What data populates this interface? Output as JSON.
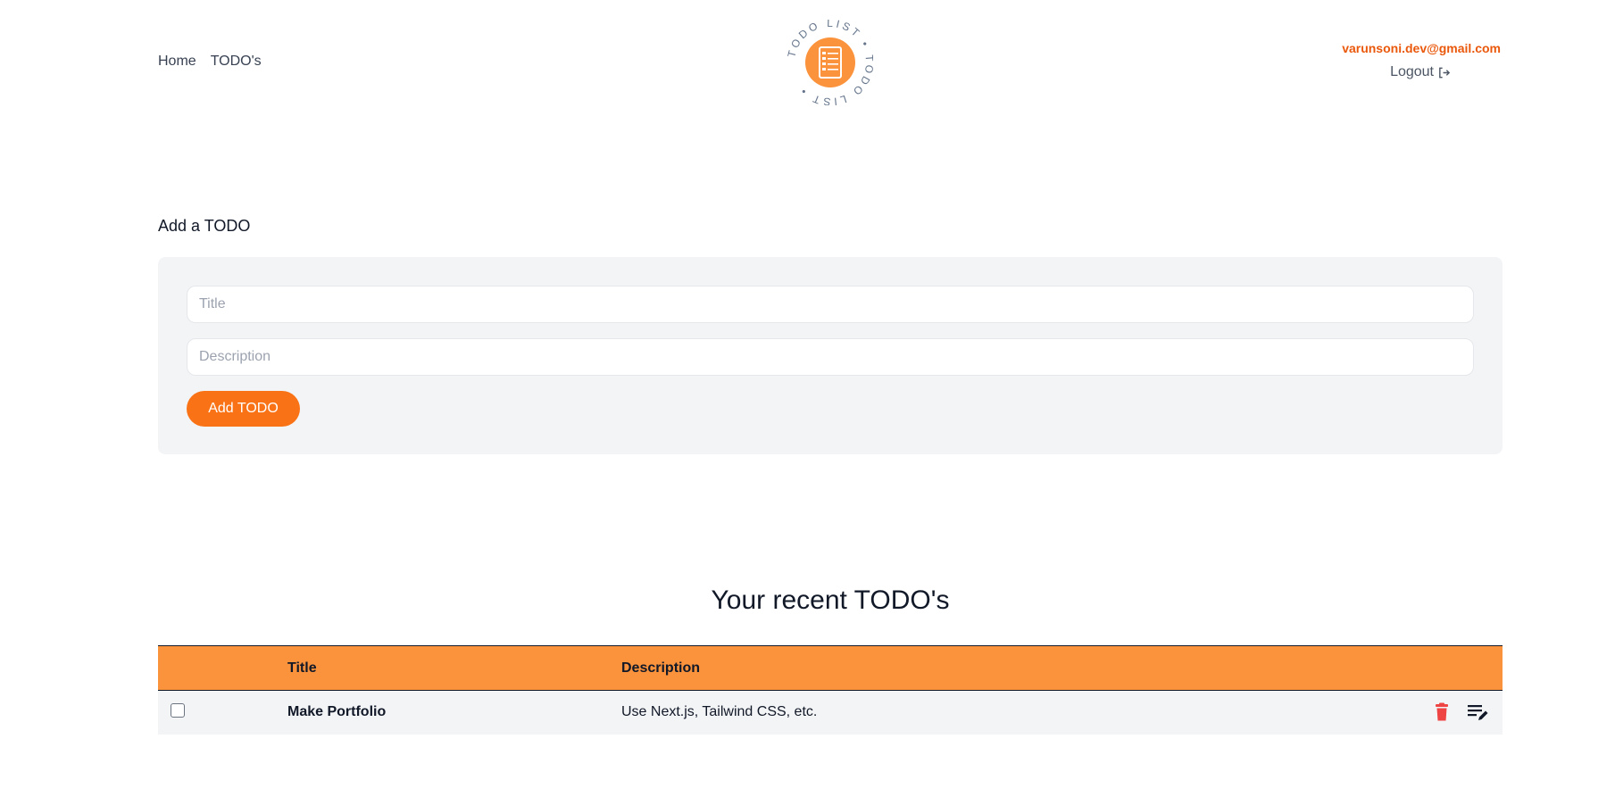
{
  "header": {
    "nav": [
      {
        "label": "Home"
      },
      {
        "label": "TODO's"
      }
    ],
    "logo": {
      "ring_text": "TODO LIST • TODO LIST •",
      "icon": "document-list-icon",
      "accent": "#fb923c"
    },
    "user_email": "varunsoni.dev@gmail.com",
    "logout_label": "Logout",
    "logout_icon": "logout-icon"
  },
  "add_form": {
    "heading": "Add a TODO",
    "title_placeholder": "Title",
    "title_value": "",
    "description_placeholder": "Description",
    "description_value": "",
    "submit_label": "Add TODO"
  },
  "recent": {
    "heading": "Your recent TODO's",
    "columns": [
      "",
      "Title",
      "Description",
      ""
    ],
    "rows": [
      {
        "checked": false,
        "title": "Make Portfolio",
        "description": "Use Next.js, Tailwind CSS, etc.",
        "delete_icon": "trash-icon",
        "edit_icon": "edit-list-icon"
      }
    ]
  },
  "colors": {
    "accent": "#f97316",
    "table_header": "#fb923c",
    "email": "#ea580c",
    "delete": "#ef4444",
    "panel": "#f3f4f6"
  }
}
